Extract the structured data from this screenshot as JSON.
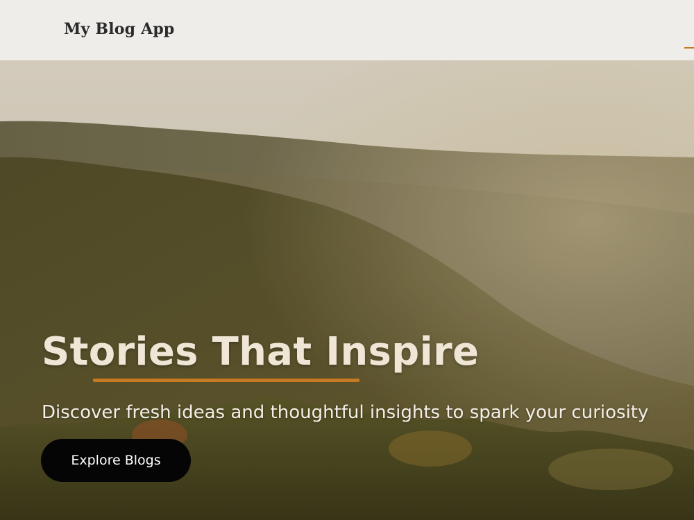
{
  "navbar": {
    "brand": "My Blog App"
  },
  "hero": {
    "title": "Stories That Inspire",
    "subtitle": "Discover fresh ideas and thoughtful insights to spark your curiosity",
    "cta_label": "Explore Blogs",
    "background_image": "forested-mountains-landscape"
  },
  "colors": {
    "accent": "#c67a21",
    "navbar_bg": "#eeedea",
    "button_bg": "#050505",
    "title_text": "#efe6d6"
  }
}
